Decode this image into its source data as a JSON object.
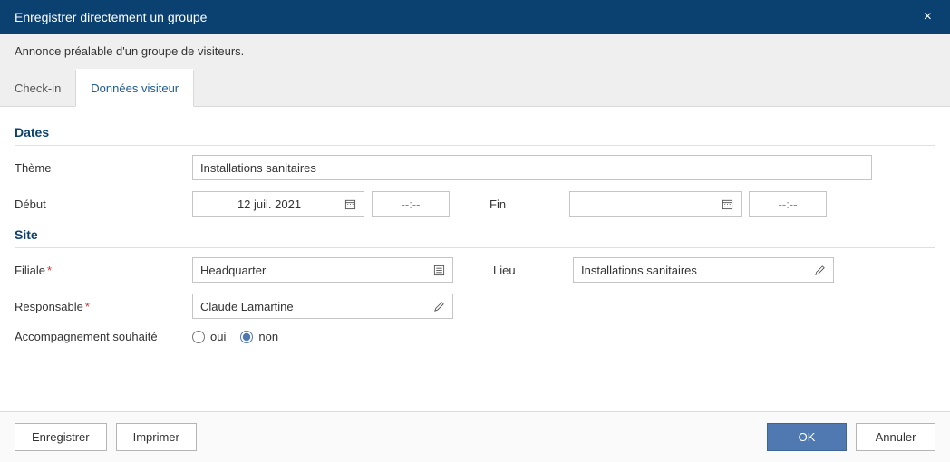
{
  "header": {
    "title": "Enregistrer directement un groupe",
    "close": "×"
  },
  "subtitle": "Annonce préalable d'un groupe de visiteurs.",
  "tabs": [
    {
      "label": "Check-in",
      "active": false
    },
    {
      "label": "Données visiteur",
      "active": true
    }
  ],
  "sections": {
    "dates": {
      "title": "Dates",
      "theme_label": "Thème",
      "theme_value": "Installations sanitaires",
      "start_label": "Début",
      "start_date": "12 juil. 2021",
      "start_time": "--:--",
      "end_label": "Fin",
      "end_date": "",
      "end_time": "--:--"
    },
    "site": {
      "title": "Site",
      "filiale_label": "Filiale",
      "filiale_value": "Headquarter",
      "lieu_label": "Lieu",
      "lieu_value": "Installations sanitaires",
      "responsable_label": "Responsable",
      "responsable_value": "Claude Lamartine",
      "accomp_label": "Accompagnement souhaité",
      "accomp_oui": "oui",
      "accomp_non": "non",
      "accomp_selected": "non"
    }
  },
  "footer": {
    "enregistrer": "Enregistrer",
    "imprimer": "Imprimer",
    "ok": "OK",
    "annuler": "Annuler"
  }
}
